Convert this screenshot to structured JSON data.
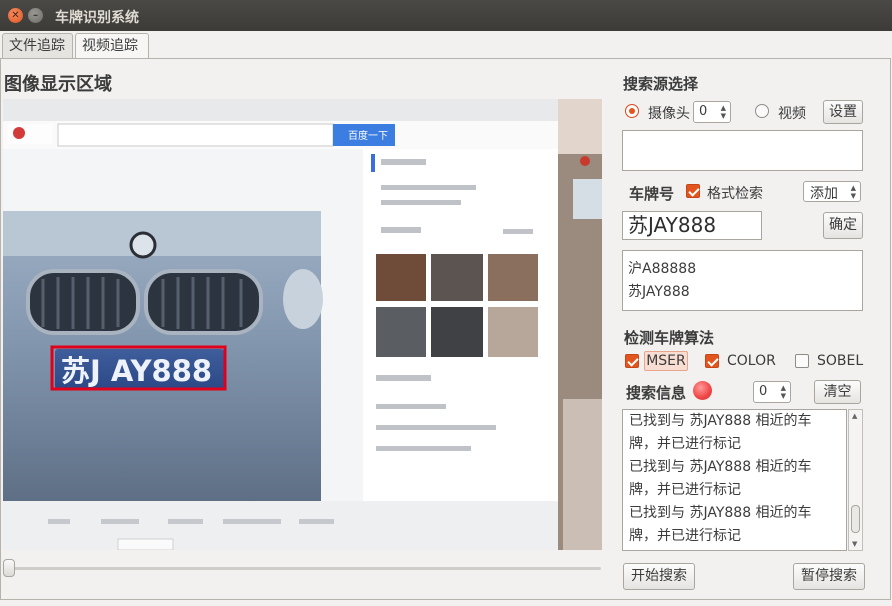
{
  "window": {
    "title": "车牌识别系统"
  },
  "tabs": [
    {
      "label": "文件追踪"
    },
    {
      "label": "视频追踪"
    }
  ],
  "display": {
    "heading": "图像显示区域",
    "plate_overlay_text": "苏J AY888",
    "browser_button": "百度一下"
  },
  "source": {
    "heading": "搜索源选择",
    "camera_label": "摄像头",
    "camera_index": "0",
    "video_label": "视频",
    "settings_button": "设置"
  },
  "plate": {
    "heading": "车牌号",
    "format_check_label": "格式检索",
    "add_select": "添加",
    "input_value": "苏JAY888",
    "confirm_button": "确定",
    "list": [
      "沪A88888",
      "苏JAY888"
    ]
  },
  "algorithm": {
    "heading": "检测车牌算法",
    "mser_label": "MSER",
    "color_label": "COLOR",
    "sobel_label": "SOBEL"
  },
  "search_info": {
    "heading": "搜索信息",
    "count": "0",
    "clear_button": "清空",
    "lines": [
      "已找到与 苏JAY888 相近的车",
      "牌，并已进行标记",
      "已找到与 苏JAY888 相近的车",
      "牌，并已进行标记",
      "已找到与 苏JAY888 相近的车",
      "牌，并已进行标记"
    ]
  },
  "actions": {
    "start_button": "开始搜索",
    "pause_button": "暂停搜索"
  },
  "colors": {
    "accent": "#e2551e",
    "detection_box": "#e0001b",
    "titlebar": "#3c3b37"
  }
}
